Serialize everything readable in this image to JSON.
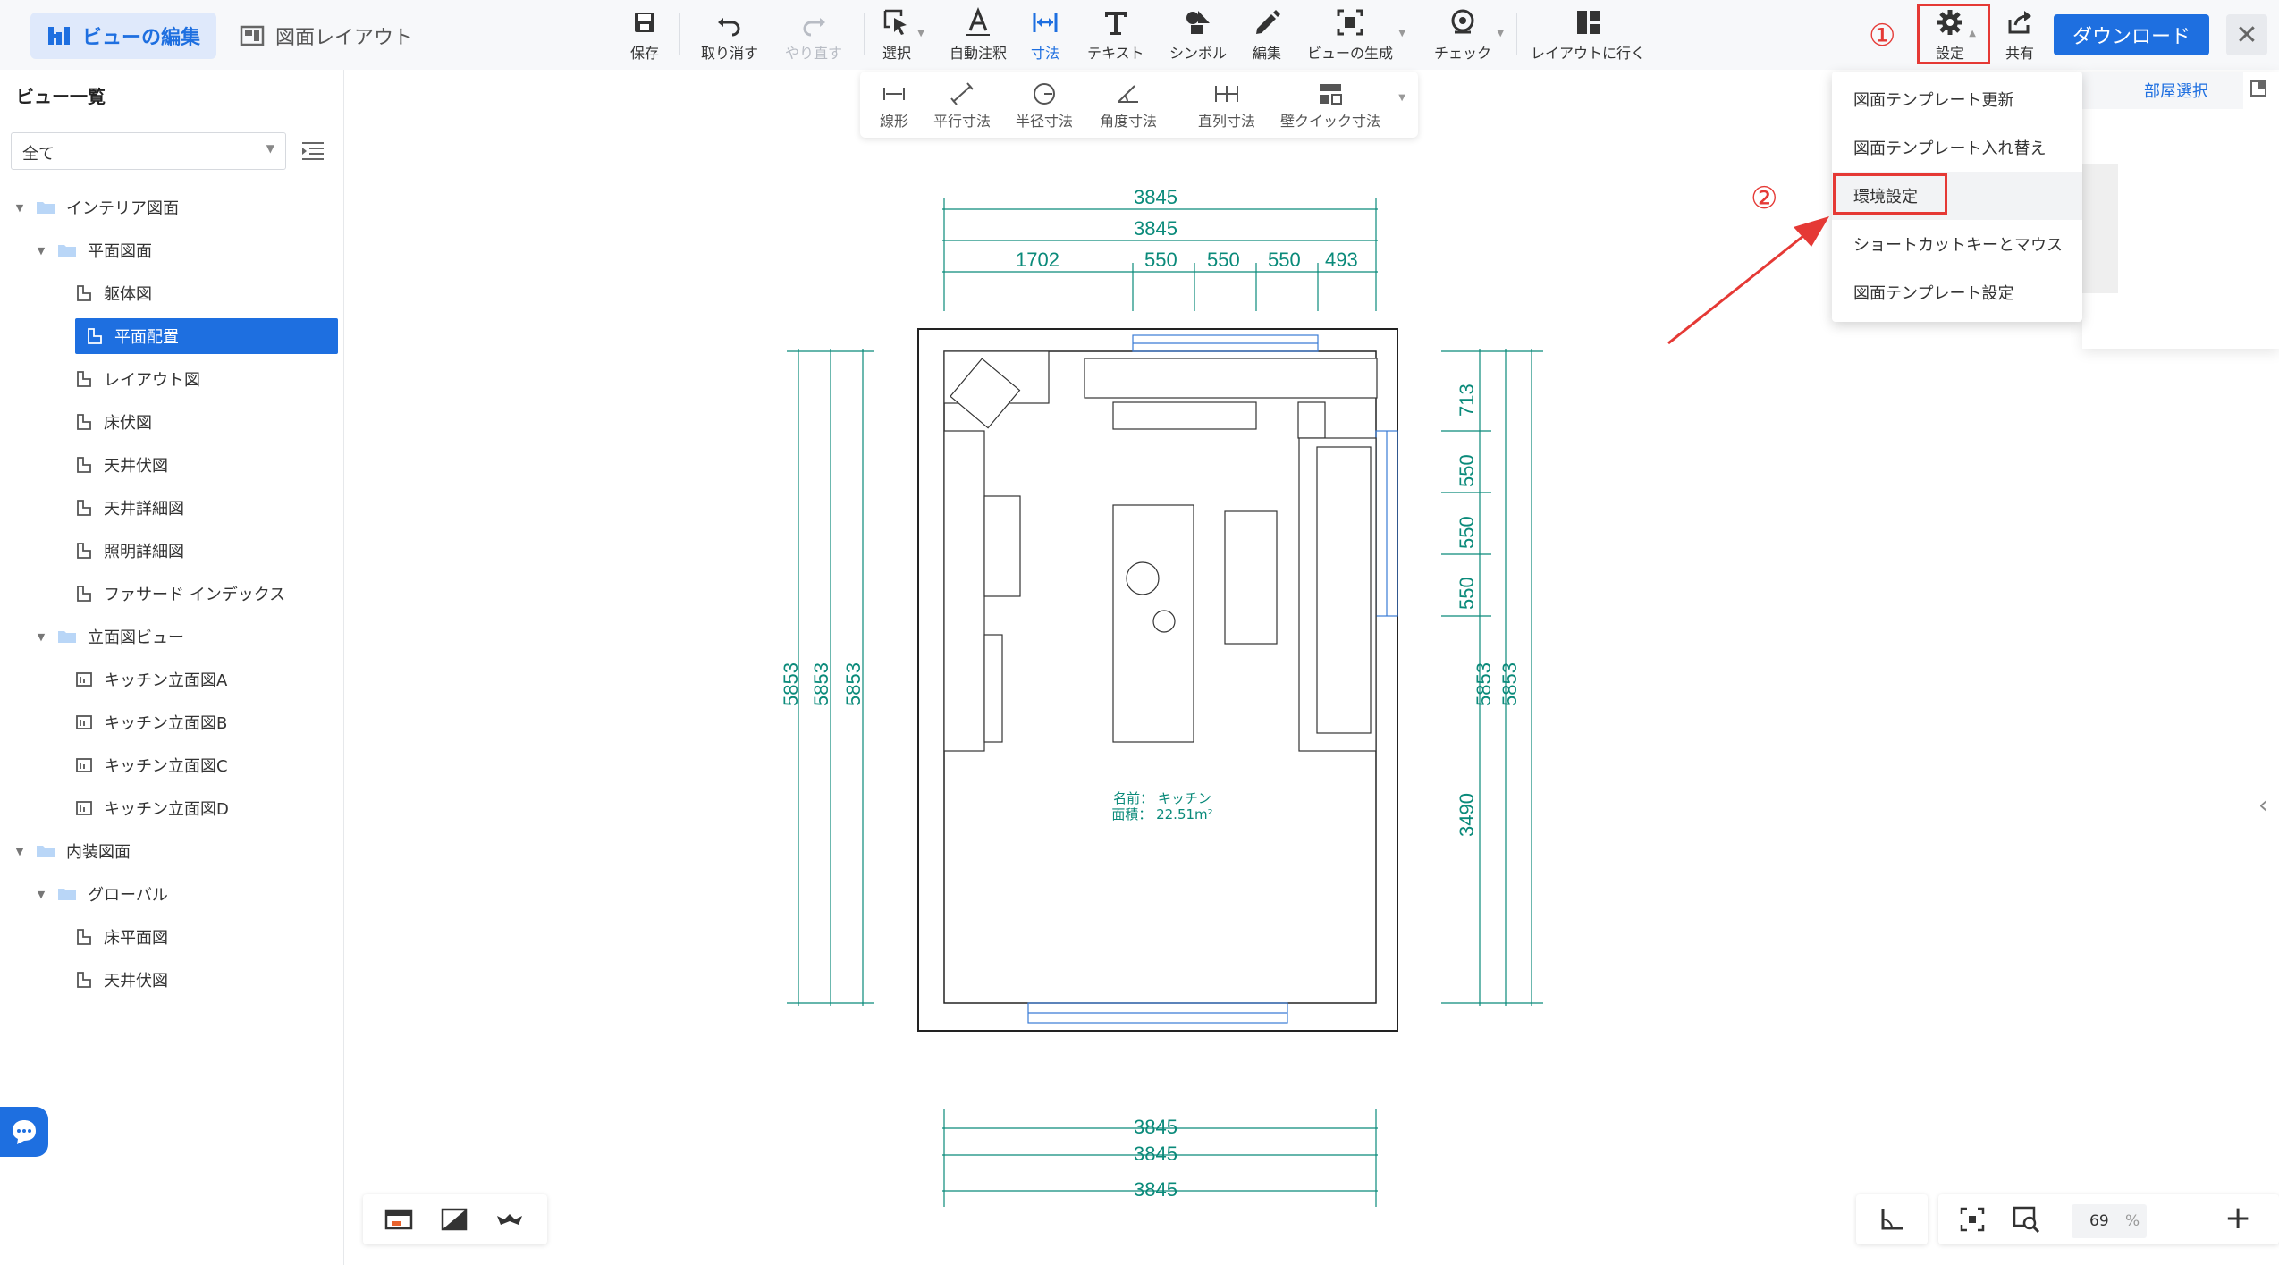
{
  "topbar": {
    "tab_edit_view": "ビューの編集",
    "tab_layout": "図面レイアウト",
    "tools": {
      "save": "保存",
      "undo": "取り消す",
      "redo": "やり直す",
      "select": "選択",
      "auto_annot": "自動注釈",
      "dimension": "寸法",
      "text": "テキスト",
      "symbol": "シンボル",
      "edit": "編集",
      "gen_view": "ビューの生成",
      "check": "チェック",
      "goto_layout": "レイアウトに行く",
      "settings": "設定",
      "share": "共有"
    },
    "download": "ダウンロード",
    "annotation_1": "①",
    "annotation_2": "②"
  },
  "subtoolbar": {
    "linear": "線形",
    "parallel": "平行寸法",
    "radius": "半径寸法",
    "angle": "角度寸法",
    "serial": "直列寸法",
    "wall_quick": "壁クイック寸法"
  },
  "settings_menu": {
    "items": [
      "図面テンプレート更新",
      "図面テンプレート入れ替え",
      "環境設定",
      "ショートカットキーとマウス",
      "図面テンプレート設定"
    ],
    "highlighted": "環境設定"
  },
  "right_panel": {
    "room_select": "部屋選択"
  },
  "sidebar": {
    "title": "ビュー一覧",
    "filter": "全て",
    "tree": [
      {
        "label": "インテリア図面",
        "level": 0,
        "type": "folder"
      },
      {
        "label": "平面図面",
        "level": 1,
        "type": "folder"
      },
      {
        "label": "躯体図",
        "level": 2,
        "type": "plan"
      },
      {
        "label": "平面配置",
        "level": 2,
        "type": "plan",
        "selected": true
      },
      {
        "label": "レイアウト図",
        "level": 2,
        "type": "plan"
      },
      {
        "label": "床伏図",
        "level": 2,
        "type": "plan"
      },
      {
        "label": "天井伏図",
        "level": 2,
        "type": "plan"
      },
      {
        "label": "天井詳細図",
        "level": 2,
        "type": "plan"
      },
      {
        "label": "照明詳細図",
        "level": 2,
        "type": "plan"
      },
      {
        "label": "ファサード インデックス",
        "level": 2,
        "type": "plan"
      },
      {
        "label": "立面図ビュー",
        "level": 1,
        "type": "folder"
      },
      {
        "label": "キッチン立面図A",
        "level": 2,
        "type": "elev"
      },
      {
        "label": "キッチン立面図B",
        "level": 2,
        "type": "elev"
      },
      {
        "label": "キッチン立面図C",
        "level": 2,
        "type": "elev"
      },
      {
        "label": "キッチン立面図D",
        "level": 2,
        "type": "elev"
      },
      {
        "label": "内装図面",
        "level": 0,
        "type": "folder"
      },
      {
        "label": "グローバル",
        "level": 1,
        "type": "folder"
      },
      {
        "label": "床平面図",
        "level": 2,
        "type": "plan"
      },
      {
        "label": "天井伏図",
        "level": 2,
        "type": "plan"
      }
    ]
  },
  "drawing": {
    "top_dims": [
      "3845",
      "3845"
    ],
    "top_segments": [
      "1702",
      "550",
      "550",
      "550",
      "493"
    ],
    "left_dims": [
      "5853",
      "5853",
      "5853"
    ],
    "right_dims": [
      "5853",
      "5853"
    ],
    "right_segments": [
      "713",
      "550",
      "550",
      "550",
      "3490"
    ],
    "bottom_dims": [
      "3845",
      "3845",
      "3845"
    ],
    "room_name": "名前：  キッチン",
    "room_area": "面積：  22.51m²"
  },
  "zoom": {
    "value": "69",
    "unit": "%"
  },
  "colors": {
    "accent": "#1e6fe0",
    "dimension": "#0a8a7a",
    "annotation": "#e53935"
  }
}
